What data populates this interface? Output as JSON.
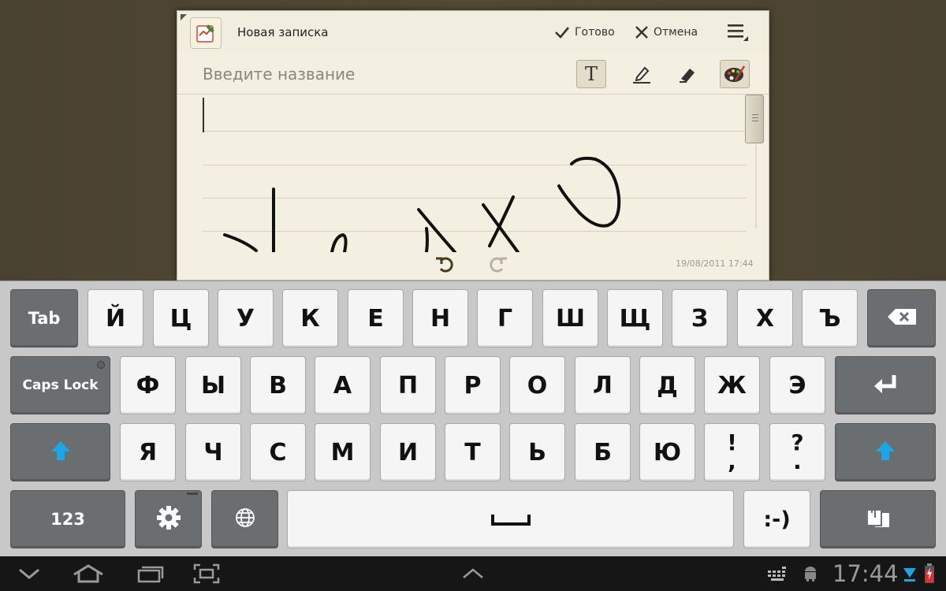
{
  "note": {
    "title": "Новая записка",
    "done_label": "Готово",
    "cancel_label": "Отмена",
    "title_placeholder": "Введите название",
    "text_tool_label": "T",
    "timestamp": "19/08/2011 17:44"
  },
  "keyboard": {
    "row1": [
      "Tab",
      "Й",
      "Ц",
      "У",
      "К",
      "Е",
      "Н",
      "Г",
      "Ш",
      "Щ",
      "З",
      "Х",
      "Ъ"
    ],
    "row2": [
      "Caps Lock",
      "Ф",
      "Ы",
      "В",
      "А",
      "П",
      "Р",
      "О",
      "Л",
      "Д",
      "Ж",
      "Э"
    ],
    "row3": [
      "Я",
      "Ч",
      "С",
      "М",
      "И",
      "Т",
      "Ь",
      "Б",
      "Ю"
    ],
    "punct1": [
      "!",
      ","
    ],
    "punct2": [
      "?",
      "."
    ],
    "numbers_label": "123",
    "smiley_label": ":-)"
  },
  "system": {
    "clock": "17:44"
  },
  "colors": {
    "accent": "#1aa7e8",
    "fn_key": "#6b6e70",
    "paper": "#f4f0e1"
  },
  "icons": [
    "app-notes-icon",
    "check-icon",
    "close-icon",
    "menu-icon",
    "text-tool-icon",
    "pen-tool-icon",
    "eraser-icon",
    "palette-icon",
    "undo-icon",
    "redo-icon",
    "backspace-icon",
    "enter-icon",
    "shift-icon",
    "settings-icon",
    "globe-icon",
    "space-icon",
    "clipboard-icon",
    "back-icon",
    "home-icon",
    "recent-apps-icon",
    "screenshot-icon",
    "up-arrow-icon",
    "keyboard-icon",
    "android-icon",
    "wifi-icon",
    "battery-icon"
  ]
}
